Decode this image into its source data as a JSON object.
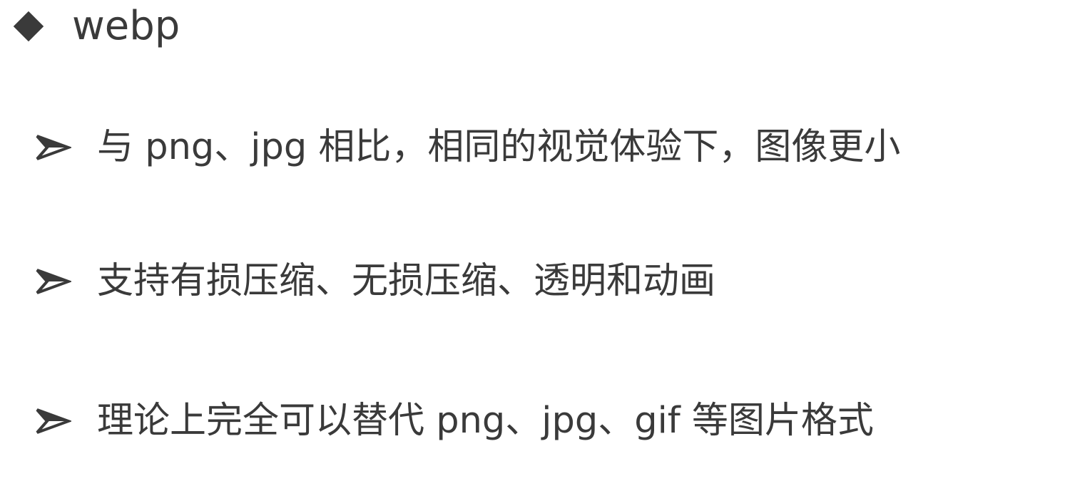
{
  "heading": {
    "icon": "diamond-icon",
    "text": "webp"
  },
  "bullets": [
    {
      "icon": "arrowhead-icon",
      "text": "与 png、jpg 相比，相同的视觉体验下，图像更小"
    },
    {
      "icon": "arrowhead-icon",
      "text": "支持有损压缩、无损压缩、透明和动画"
    },
    {
      "icon": "arrowhead-icon",
      "text": "理论上完全可以替代 png、jpg、gif 等图片格式"
    }
  ],
  "colors": {
    "text": "#3a3a3a",
    "background": "#ffffff"
  }
}
